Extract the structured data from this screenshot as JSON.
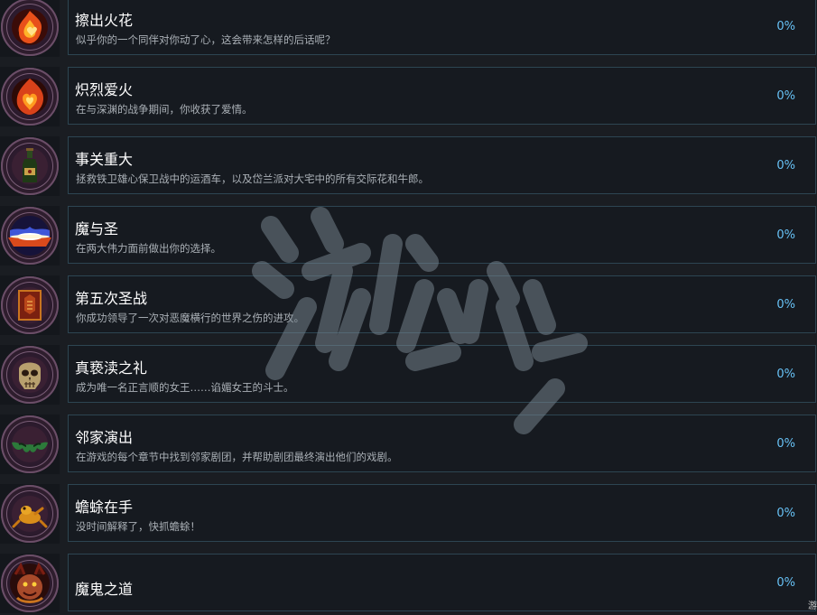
{
  "achievements": [
    {
      "title": "擦出火花",
      "description": "似乎你的一个同伴对你动了心，这会带来怎样的后话呢？",
      "percent": "0%",
      "icon": "flaming-hearts-icon"
    },
    {
      "title": "炽烈爱火",
      "description": "在与深渊的战争期间，你收获了爱情。",
      "percent": "0%",
      "icon": "flaming-heart-icon"
    },
    {
      "title": "事关重大",
      "description": "拯救铁卫雄心保卫战中的运酒车，以及岱兰派对大宅中的所有交际花和牛郎。",
      "percent": "0%",
      "icon": "wine-bottle-icon"
    },
    {
      "title": "魔与圣",
      "description": "在两大伟力面前做出你的选择。",
      "percent": "0%",
      "icon": "light-burst-icon"
    },
    {
      "title": "第五次圣战",
      "description": "你成功领导了一次对恶魔横行的世界之伤的进攻。",
      "percent": "0%",
      "icon": "crusade-banner-icon"
    },
    {
      "title": "真亵渎之礼",
      "description": "成为唯一名正言顺的女王……谄媚女王的斗士。",
      "percent": "0%",
      "icon": "skull-icon"
    },
    {
      "title": "邻家演出",
      "description": "在游戏的每个章节中找到邻家剧团，并帮助剧团最终演出他们的戏剧。",
      "percent": "0%",
      "icon": "theater-mask-icon"
    },
    {
      "title": "蟾蜍在手",
      "description": "没时间解释了，快抓蟾蜍！",
      "percent": "0%",
      "icon": "golden-toad-icon"
    },
    {
      "title": "魔鬼之道",
      "description": "",
      "percent": "0%",
      "icon": "devil-face-icon"
    }
  ],
  "watermark": "游侠网",
  "corner_text": "游",
  "colors": {
    "background": "#1a1d22",
    "card": "#161a20",
    "card_border": "#2d4552",
    "percent": "#67c1f5"
  }
}
